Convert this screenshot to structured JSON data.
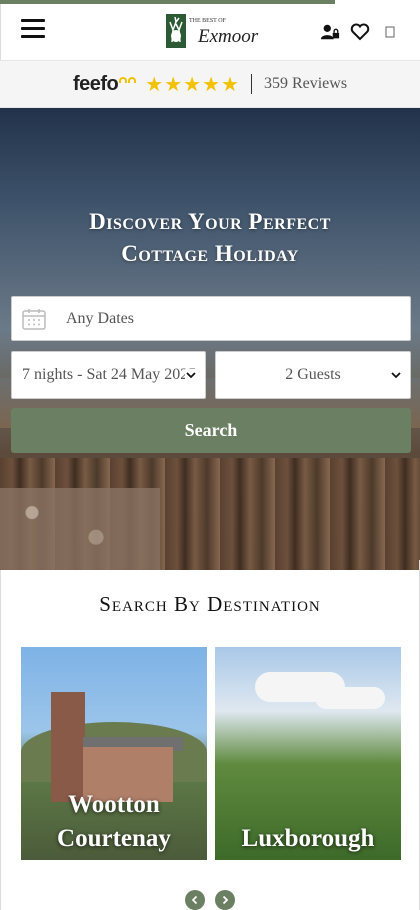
{
  "header": {
    "menu_icon": "hamburger-menu-icon",
    "logo_top": "THE BEST OF",
    "logo_main": "Exmoor",
    "icons": [
      "account-lock-icon",
      "heart-icon",
      "basket-icon"
    ]
  },
  "feefo": {
    "logo": "feefo",
    "rating_stars": 5,
    "reviews": "359 Reviews",
    "star_color": "#f2c200"
  },
  "hero": {
    "title_line1": "Discover Your Perfect",
    "title_line2": "Cottage Holiday"
  },
  "search_form": {
    "dates_placeholder": "Any Dates",
    "nights_value": "7 nights - Sat 24 May 2025",
    "guests_value": "2 Guests",
    "search_label": "Search"
  },
  "destinations": {
    "title": "Search By Destination",
    "cards": [
      {
        "label_line1": "Wootton",
        "label_line2": "Courtenay"
      },
      {
        "label_line1": "Luxborough"
      }
    ]
  },
  "colors": {
    "accent": "#6b7f62",
    "star": "#f2c200"
  }
}
